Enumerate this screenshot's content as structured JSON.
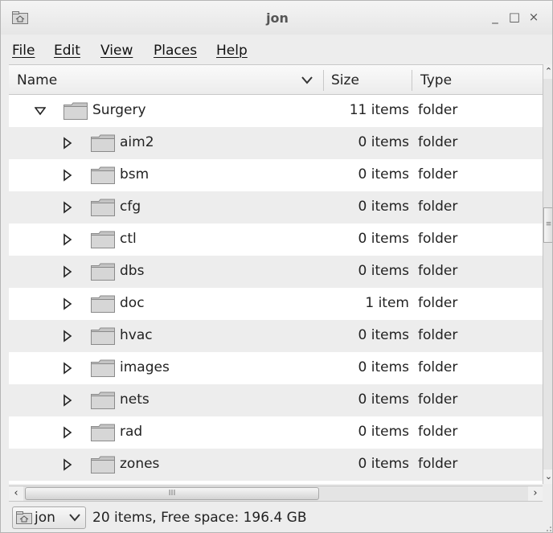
{
  "window": {
    "title": "jon"
  },
  "titlebar_buttons": {
    "minimize": "_",
    "maximize": "□",
    "close": "×"
  },
  "menu": {
    "items": [
      "File",
      "Edit",
      "View",
      "Places",
      "Help"
    ]
  },
  "columns": {
    "name": "Name",
    "size": "Size",
    "type": "Type"
  },
  "rows": [
    {
      "name": "Surgery",
      "size": "11 items",
      "type": "folder",
      "expanded": true
    },
    {
      "name": "aim2",
      "size": "0 items",
      "type": "folder",
      "expanded": false
    },
    {
      "name": "bsm",
      "size": "0 items",
      "type": "folder",
      "expanded": false
    },
    {
      "name": "cfg",
      "size": "0 items",
      "type": "folder",
      "expanded": false
    },
    {
      "name": "ctl",
      "size": "0 items",
      "type": "folder",
      "expanded": false
    },
    {
      "name": "dbs",
      "size": "0 items",
      "type": "folder",
      "expanded": false
    },
    {
      "name": "doc",
      "size": "1 item",
      "type": "folder",
      "expanded": false
    },
    {
      "name": "hvac",
      "size": "0 items",
      "type": "folder",
      "expanded": false
    },
    {
      "name": "images",
      "size": "0 items",
      "type": "folder",
      "expanded": false
    },
    {
      "name": "nets",
      "size": "0 items",
      "type": "folder",
      "expanded": false
    },
    {
      "name": "rad",
      "size": "0 items",
      "type": "folder",
      "expanded": false
    },
    {
      "name": "zones",
      "size": "0 items",
      "type": "folder",
      "expanded": false
    }
  ],
  "statusbar": {
    "location_label": "jon",
    "status_text": "20 items, Free space: 196.4 GB"
  },
  "icons": {
    "app": "home-folder-icon",
    "folder": "folder-icon",
    "expander_collapsed": "triangle-right-icon",
    "expander_expanded": "triangle-down-icon"
  }
}
